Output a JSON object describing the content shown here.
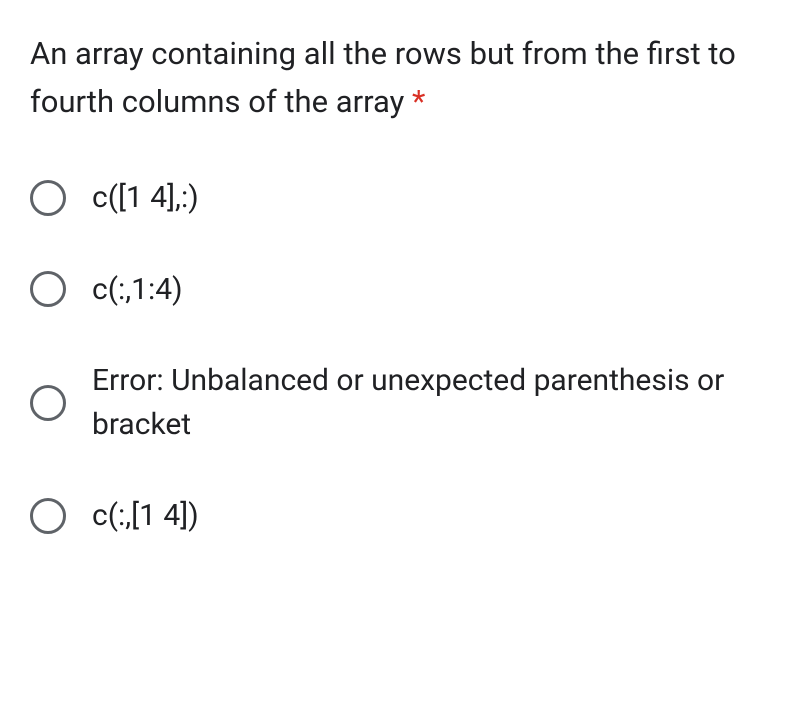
{
  "question": {
    "text": "An array containing all the rows but from the first to fourth columns of the array ",
    "required_marker": "*"
  },
  "options": [
    {
      "label": "c([1 4],:)"
    },
    {
      "label": "c(:,1:4)"
    },
    {
      "label": "Error: Unbalanced or unexpected parenthesis or bracket"
    },
    {
      "label": "c(:,[1 4])"
    }
  ]
}
